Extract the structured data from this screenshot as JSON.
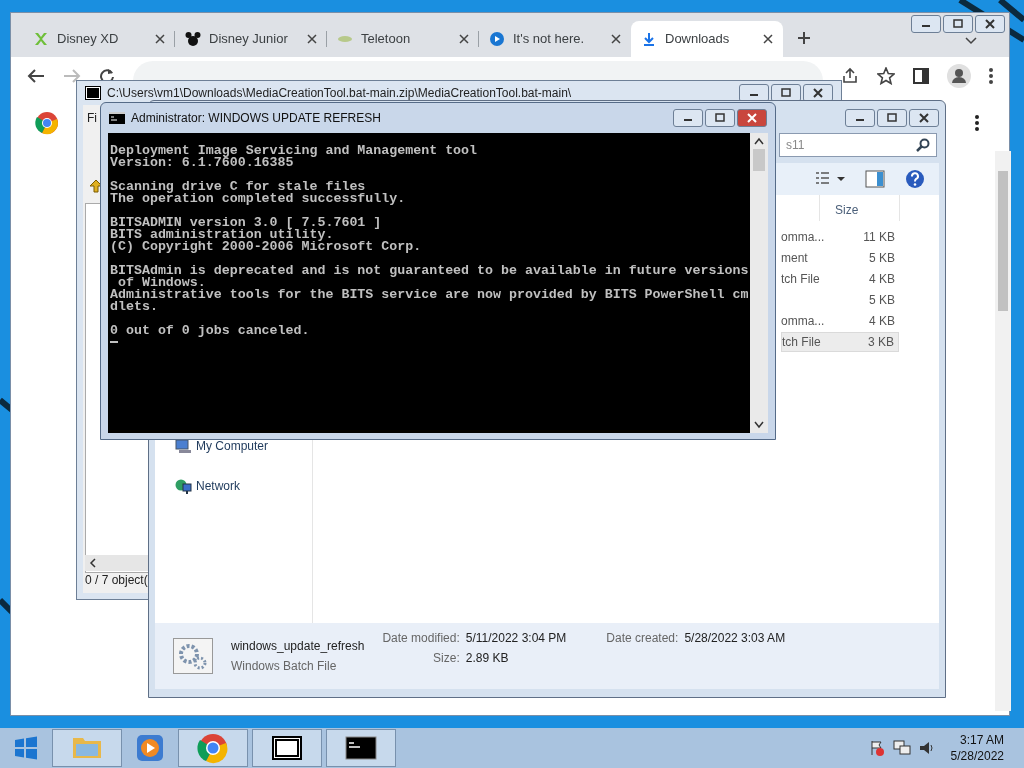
{
  "browser": {
    "tabs": [
      {
        "kind": "xd",
        "label": "Disney XD",
        "selected": false
      },
      {
        "kind": "mouse",
        "label": "Disney Junior",
        "selected": false
      },
      {
        "kind": "leaf",
        "label": "Teletoon",
        "selected": false
      },
      {
        "kind": "play",
        "label": "It's not here.",
        "selected": false
      },
      {
        "kind": "download",
        "label": "Downloads",
        "selected": true
      }
    ]
  },
  "archive_window": {
    "title": "C:\\Users\\vm1\\Downloads\\MediaCreationTool.bat-main.zip\\MediaCreationTool.bat-main\\",
    "menu": "Fi",
    "status": "0 / 7 object("
  },
  "explorer": {
    "search": "s11",
    "column": "Size",
    "rows": [
      {
        "type": "omma...",
        "size": "11 KB",
        "selected": false
      },
      {
        "type": "ment",
        "size": "5 KB",
        "selected": false
      },
      {
        "type": "tch File",
        "size": "4 KB",
        "selected": false
      },
      {
        "type": "",
        "size": "5 KB",
        "selected": false
      },
      {
        "type": "omma...",
        "size": "4 KB",
        "selected": false
      },
      {
        "type": "tch File",
        "size": "3 KB",
        "selected": true
      }
    ],
    "nav": [
      {
        "kind": "computer",
        "label": "My Computer"
      },
      {
        "kind": "network",
        "label": "Network"
      }
    ],
    "details": {
      "name": "windows_update_refresh",
      "type": "Windows Batch File",
      "fields": [
        {
          "label": "Date modified:",
          "value": "5/11/2022 3:04 PM"
        },
        {
          "label": "Size:",
          "value": "2.89 KB"
        },
        {
          "label": "Date created:",
          "value": "5/28/2022 3:03 AM"
        }
      ]
    }
  },
  "console": {
    "title": "Administrator:  WINDOWS UPDATE REFRESH",
    "blocks": [
      "Deployment Image Servicing and Management tool\nVersion: 6.1.7600.16385",
      "Scanning drive C for stale files\nThe operation completed successfully.",
      "BITSADMIN version 3.0 [ 7.5.7601 ]\nBITS administration utility.\n(C) Copyright 2000-2006 Microsoft Corp.",
      "BITSAdmin is deprecated and is not guaranteed to be available in future versions\n of Windows.\nAdministrative tools for the BITS service are now provided by BITS PowerShell cm\ndlets.",
      "0 out of 0 jobs canceled."
    ]
  },
  "taskbar": {
    "apps": [
      {
        "kind": "explorer",
        "running": true
      },
      {
        "kind": "media",
        "running": false
      },
      {
        "kind": "chrome",
        "running": true
      },
      {
        "kind": "sevenzip",
        "running": true
      },
      {
        "kind": "console",
        "running": true
      }
    ],
    "time": "3:17 AM",
    "date": "5/28/2022"
  }
}
